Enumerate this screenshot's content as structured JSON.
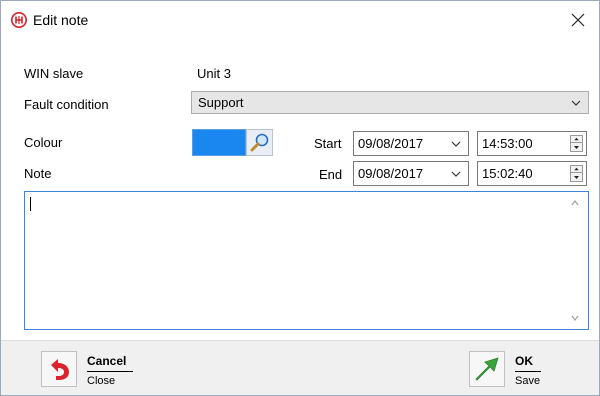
{
  "window": {
    "title": "Edit note",
    "app_icon": "app-logo-icon",
    "close_icon": "close-icon"
  },
  "form": {
    "win_slave_label": "WIN slave",
    "win_slave_value": "Unit 3",
    "fault_label": "Fault condition",
    "fault_value": "Support",
    "colour_label": "Colour",
    "colour_value": "#1a86f0",
    "note_label": "Note",
    "start_label": "Start",
    "start_date": "09/08/2017",
    "start_time": "14:53:00",
    "end_label": "End",
    "end_date": "09/08/2017",
    "end_time": "15:02:40",
    "note_text": ""
  },
  "actions": {
    "cancel": {
      "label": "Cancel",
      "sub": "Close",
      "icon": "undo-arrow-icon"
    },
    "ok": {
      "label": "OK",
      "sub": "Save",
      "icon": "green-arrow-icon"
    }
  },
  "colors": {
    "accent": "#3b84d6",
    "cancel_icon": "#d9232e",
    "ok_icon": "#3aa63a"
  }
}
